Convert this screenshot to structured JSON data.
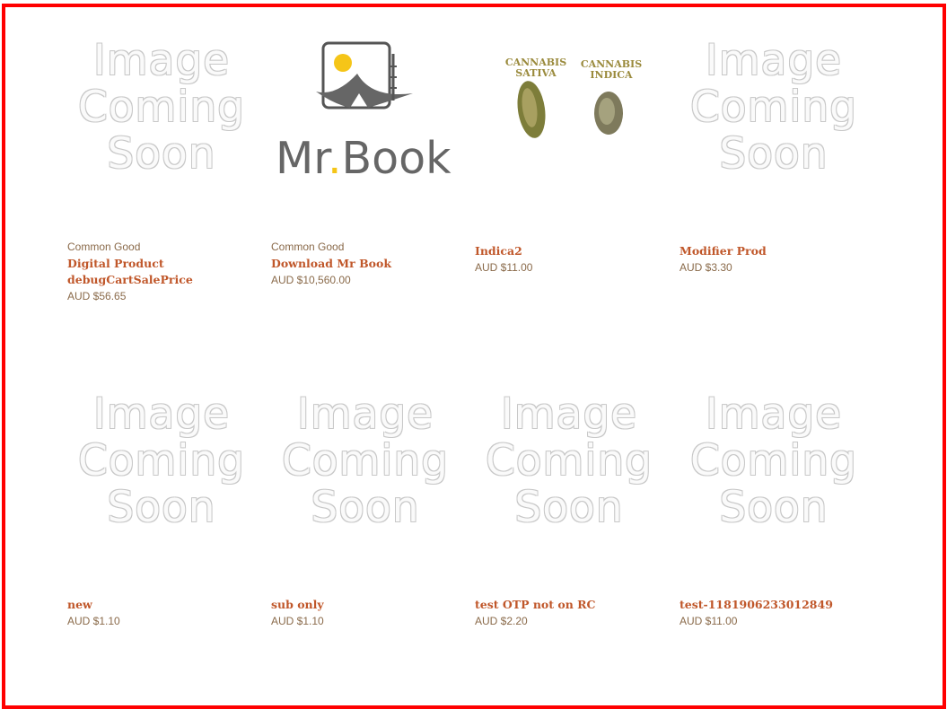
{
  "placeholder": {
    "line1": "Image",
    "line2": "Coming",
    "line3": "Soon"
  },
  "products": [
    {
      "brand": "Common Good",
      "title": "Digital Product debugCartSalePrice",
      "price": "AUD $56.65",
      "image": "placeholder"
    },
    {
      "brand": "Common Good",
      "title": "Download Mr Book",
      "price": "AUD $10,560.00",
      "image": "mr-book-logo"
    },
    {
      "brand": "",
      "title": "Indica2",
      "price": "AUD $11.00",
      "image": "cannabis-photo"
    },
    {
      "brand": "",
      "title": "Modifier Prod",
      "price": "AUD $3.30",
      "image": "placeholder"
    },
    {
      "brand": "",
      "title": "new",
      "price": "AUD $1.10",
      "image": "placeholder"
    },
    {
      "brand": "",
      "title": "sub only",
      "price": "AUD $1.10",
      "image": "placeholder"
    },
    {
      "brand": "",
      "title": "test OTP not on RC",
      "price": "AUD $2.20",
      "image": "placeholder"
    },
    {
      "brand": "",
      "title": "test-1181906233012849",
      "price": "AUD $11.00",
      "image": "placeholder"
    }
  ],
  "mr_book": {
    "logo_text_mr": "Mr",
    "logo_text_dot": ".",
    "logo_text_book": "Book"
  },
  "cannabis": {
    "sativa_line1": "CANNABIS",
    "sativa_line2": "SATIVA",
    "indica_line1": "CANNABIS",
    "indica_line2": "INDICA"
  },
  "colors": {
    "frame": "#ff0000",
    "title": "#c0572a",
    "meta": "#8a6a4a",
    "logo_dot": "#f5c518"
  }
}
